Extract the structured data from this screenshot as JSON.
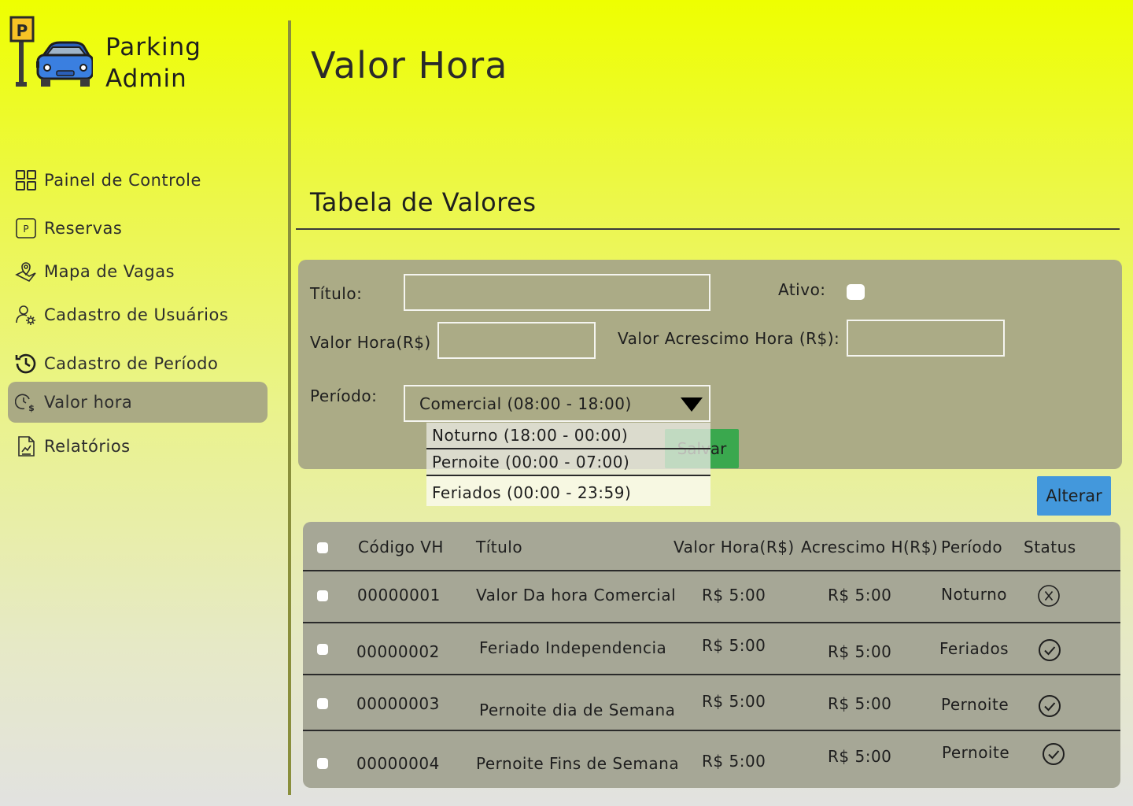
{
  "app": {
    "title_line1": "Parking",
    "title_line2": "Admin"
  },
  "sidebar": {
    "items": [
      {
        "label": "Painel de Controle",
        "icon": "dashboard-icon"
      },
      {
        "label": "Reservas",
        "icon": "parking-p-icon"
      },
      {
        "label": "Mapa de Vagas",
        "icon": "map-pin-icon"
      },
      {
        "label": "Cadastro de Usuários",
        "icon": "user-settings-icon"
      },
      {
        "label": "Cadastro de Período",
        "icon": "history-clock-icon"
      },
      {
        "label": "Valor hora",
        "icon": "clock-money-icon",
        "active": true
      },
      {
        "label": "Relatórios",
        "icon": "report-icon"
      }
    ]
  },
  "header": {
    "page_title": "Valor Hora",
    "section_title": "Tabela de Valores"
  },
  "form": {
    "titulo_label": "Título:",
    "titulo_value": "",
    "ativo_label": "Ativo:",
    "ativo_checked": false,
    "valor_hora_label": "Valor Hora(R$) :",
    "valor_hora_value": "",
    "acrescimo_label": "Valor Acrescimo Hora (R$):",
    "acrescimo_value": "",
    "periodo_label": "Período:",
    "periodo_selected": "Comercial (08:00 - 18:00)",
    "periodo_options": [
      "Noturno (18:00 - 00:00)",
      "Pernoite (00:00 - 07:00)",
      "Feriados (00:00 - 23:59)"
    ],
    "salvar_label": "Salvar"
  },
  "alterar_label": "Alterar",
  "table": {
    "headers": [
      "Código VH",
      "Título",
      "Valor Hora(R$)",
      "Acrescimo H(R$)",
      "Período",
      "Status"
    ],
    "rows": [
      {
        "codigo": "00000001",
        "titulo": "Valor Da hora Comercial",
        "valor": "R$ 5:00",
        "acrescimo": "R$ 5:00",
        "periodo": "Noturno",
        "status": "inactive"
      },
      {
        "codigo": "00000002",
        "titulo": "Feriado Independencia",
        "valor": "R$ 5:00",
        "acrescimo": "R$ 5:00",
        "periodo": "Feriados",
        "status": "active"
      },
      {
        "codigo": "00000003",
        "titulo": "Pernoite dia de Semana",
        "valor": "R$ 5:00",
        "acrescimo": "R$ 5:00",
        "periodo": "Pernoite",
        "status": "active"
      },
      {
        "codigo": "00000004",
        "titulo": "Pernoite Fins de Semana",
        "valor": "R$ 5:00",
        "acrescimo": "R$ 5:00",
        "periodo": "Pernoite",
        "status": "active"
      }
    ]
  },
  "colors": {
    "accent_yellow": "#eeff00",
    "panel": "#abab86",
    "save_green": "#3aa84e",
    "alter_blue": "#4398dc"
  }
}
